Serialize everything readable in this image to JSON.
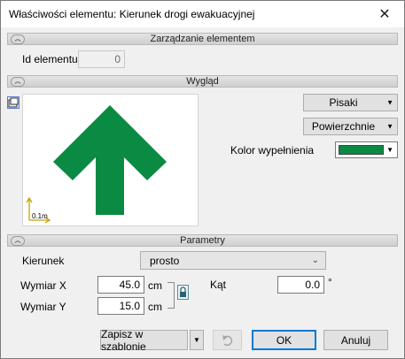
{
  "window": {
    "title": "Właściwości elementu: Kierunek drogi ewakuacyjnej",
    "close_glyph": "✕"
  },
  "sections": {
    "management": {
      "label": "Zarządzanie elementem",
      "collapse_glyph": "︽"
    },
    "appearance": {
      "label": "Wygląd",
      "collapse_glyph": "︽"
    },
    "parameters": {
      "label": "Parametry",
      "collapse_glyph": "︽"
    }
  },
  "management": {
    "id_label": "Id elementu",
    "id_value": "0"
  },
  "appearance": {
    "pens_label": "Pisaki",
    "surfaces_label": "Powierzchnie",
    "fill_color_label": "Kolor wypełnienia",
    "fill_color": "#0b8a44",
    "arrow_color": "#0b8a44",
    "scale_label": "0.1m",
    "dropdown_glyph": "▼"
  },
  "parameters": {
    "direction_label": "Kierunek",
    "direction_value": "prosto",
    "dimension_x_label": "Wymiar X",
    "dimension_x_value": "45.0",
    "dimension_x_unit": "cm",
    "dimension_y_label": "Wymiar Y",
    "dimension_y_value": "15.0",
    "dimension_y_unit": "cm",
    "angle_label": "Kąt",
    "angle_value": "0.0",
    "angle_unit": "°"
  },
  "footer": {
    "save_template_label": "Zapisz w szablonie",
    "ok_label": "OK",
    "cancel_label": "Anuluj"
  }
}
